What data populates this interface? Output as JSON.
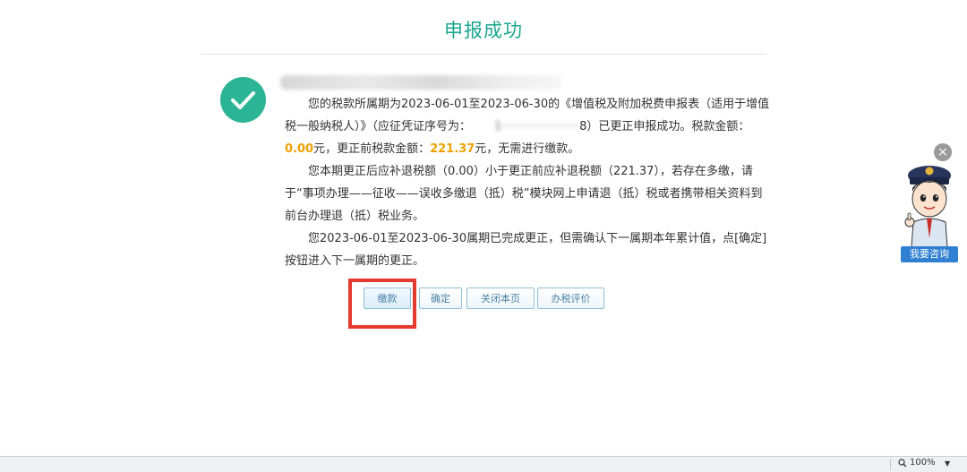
{
  "page": {
    "title": "申报成功"
  },
  "message": {
    "p1_a": "您的税款所属期为2023-06-01至2023-06-30的《增值税及附加税费申报表（适用于增值税一般纳税人）》（应征凭证序号为：",
    "p1_serial_tail": "8",
    "p1_b": "）已更正申报成功。税款金额：",
    "tax_amount": "0.00",
    "p1_c": "元，更正前税款金额：",
    "prev_amount": "221.37",
    "p1_d": "元，无需进行缴款。",
    "p2": "您本期更正后应补退税额（0.00）小于更正前应补退税额（221.37），若存在多缴，请于“事项办理——征收——误收多缴退（抵）税”模块网上申请退（抵）税或者携带相关资料到前台办理退（抵）税业务。",
    "p3": "您2023-06-01至2023-06-30属期已完成更正，但需确认下一属期本年累计值，点[确定]按钮进入下一属期的更正。"
  },
  "buttons": {
    "pay": "缴款",
    "confirm": "确定",
    "close_page": "关闭本页",
    "evaluate": "办税评价"
  },
  "assistant": {
    "close_glyph": "×",
    "label": "我要咨询"
  },
  "status_bar": {
    "zoom": "100%",
    "zoom_icon": "magnifier-icon",
    "dropdown_glyph": "▼"
  },
  "colors": {
    "title": "#1aa68f",
    "success_circle": "#2bb595",
    "amount": "#f0a000",
    "highlight_box": "#e53a30",
    "assistant_label": "#2f7fd3"
  }
}
